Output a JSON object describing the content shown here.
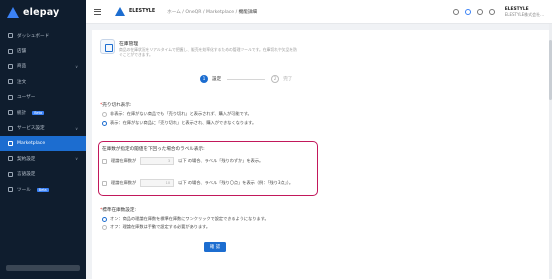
{
  "sidebar": {
    "logo": "elepay",
    "items": [
      {
        "label": "ダッシュボード",
        "chevron": "",
        "badge": ""
      },
      {
        "label": "店舗",
        "chevron": "",
        "badge": ""
      },
      {
        "label": "商品",
        "chevron": "∨",
        "badge": ""
      },
      {
        "label": "注文",
        "chevron": "",
        "badge": ""
      },
      {
        "label": "ユーザー",
        "chevron": "",
        "badge": ""
      },
      {
        "label": "統計",
        "chevron": "",
        "badge": "Beta"
      },
      {
        "label": "サービス設定",
        "chevron": "∨",
        "badge": ""
      },
      {
        "label": "Marketplace",
        "chevron": "",
        "badge": ""
      },
      {
        "label": "契約設定",
        "chevron": "∨",
        "badge": ""
      },
      {
        "label": "言語設定",
        "chevron": "",
        "badge": ""
      },
      {
        "label": "ツール",
        "chevron": "",
        "badge": "Beta"
      }
    ]
  },
  "header": {
    "brand": "ELESTYLE",
    "crumb_home": "ホーム",
    "crumb_sep": "/",
    "crumb_1": "OneQR",
    "crumb_2": "Marketplace",
    "crumb_cur": "機能詳細",
    "user_name": "ELESTYLE",
    "user_sub": "ELESTYLE株式会社..."
  },
  "app": {
    "title": "在庫管理",
    "desc": "商品の在庫状況をリアルタイムで把握し、販売を効率化するための管理ツールです。在庫切れや欠品を防ぐことができます。"
  },
  "steps": {
    "step1_num": "1",
    "step1_label": "設定",
    "step2_num": "2",
    "step2_label": "完了"
  },
  "sold_out": {
    "label": "売り切れ表示",
    "opt1": "非表示：在庫がない商品でも「売り切れ」と表示されず、購入が可能です。",
    "opt2": "表示：在庫がない商品に「売り切れ」と表示され、購入ができなくなります。"
  },
  "threshold": {
    "label": "在庫数が指定の閾値を下回った場合のラベル表示:",
    "row1_prefix": "理論在庫数が",
    "row1_value": "3",
    "row1_suffix": "以下 の場合、ラベル「残りわずか」を表示。",
    "row2_prefix": "理論在庫数が",
    "row2_value": "10",
    "row2_suffix": "以下 の場合、ラベル「残り〇点」を表示（例：「残り3点」）。"
  },
  "standard": {
    "label": "標準在庫数設定:",
    "opt1": "オン：商品の理論在庫数を標準在庫数にワンクリックで設定できるようになります。",
    "opt2": "オフ：理論在庫数は手動で設定する必要があります。"
  },
  "confirm_label": "確 認"
}
